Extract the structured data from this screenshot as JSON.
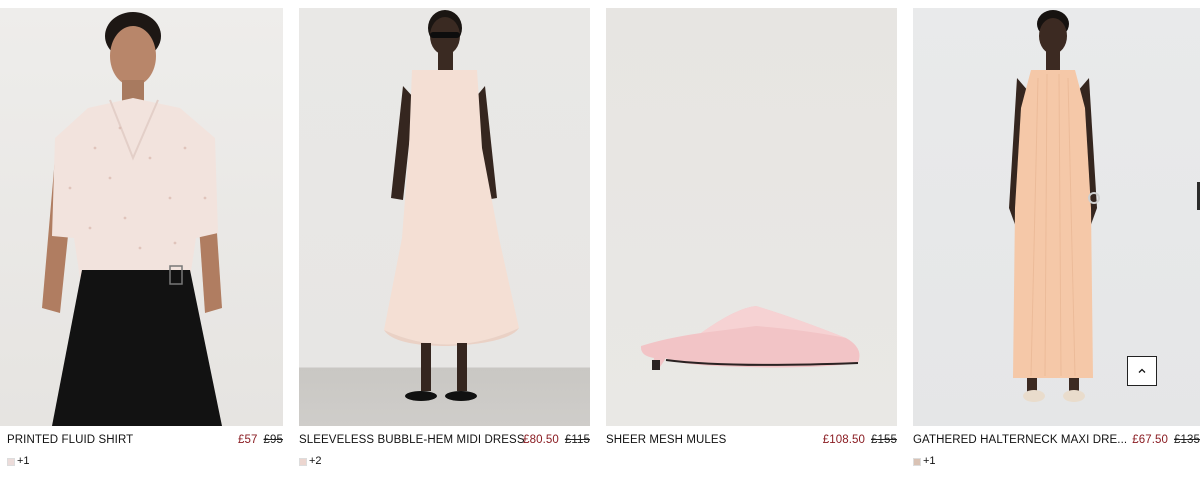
{
  "products": [
    {
      "name": "PRINTED FLUID SHIRT",
      "price_now": "£57",
      "price_was": "£95",
      "swatch_color": "#ecdcda",
      "more_colors": "+1",
      "image_icon": "model-shirt-image"
    },
    {
      "name": "SLEEVELESS BUBBLE-HEM MIDI DRESS",
      "price_now": "£80.50",
      "price_was": "£115",
      "swatch_color": "#ecd6d0",
      "more_colors": "+2",
      "image_icon": "model-dress-image"
    },
    {
      "name": "SHEER MESH MULES",
      "price_now": "£108.50",
      "price_was": "£155",
      "image_icon": "mule-shoe-image"
    },
    {
      "name": "GATHERED HALTERNECK MAXI DRE...",
      "price_now": "£67.50",
      "price_was": "£135",
      "swatch_color": "#d9c2b4",
      "more_colors": "+1",
      "image_icon": "model-maxi-dress-image"
    }
  ],
  "back_to_top": {
    "icon": "chevron-up-icon"
  },
  "colors": {
    "sale_price": "#8a1c22",
    "text": "#111111"
  }
}
